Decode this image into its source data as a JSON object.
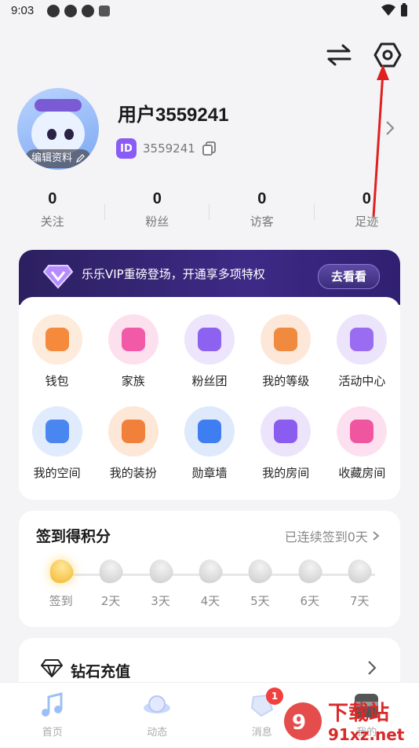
{
  "status_bar": {
    "time": "9:03"
  },
  "profile": {
    "username": "用户3559241",
    "id_badge": "ID",
    "user_id": "3559241",
    "edit_label": "编辑资料"
  },
  "stats": [
    {
      "value": "0",
      "label": "关注"
    },
    {
      "value": "0",
      "label": "粉丝"
    },
    {
      "value": "0",
      "label": "访客"
    },
    {
      "value": "0",
      "label": "足迹"
    }
  ],
  "vip": {
    "text": "乐乐VIP重磅登场，开通享多项特权",
    "button": "去看看"
  },
  "grid": [
    {
      "label": "钱包",
      "icon": "wallet-icon",
      "bg": "#fdebdc",
      "fg": "#f58a3c"
    },
    {
      "label": "家族",
      "icon": "family-icon",
      "bg": "#fde0ee",
      "fg": "#f25aa8"
    },
    {
      "label": "粉丝团",
      "icon": "fan-club-icon",
      "bg": "#ece5fb",
      "fg": "#8e62f0"
    },
    {
      "label": "我的等级",
      "icon": "level-icon",
      "bg": "#fde7d8",
      "fg": "#f08a3e"
    },
    {
      "label": "活动中心",
      "icon": "gift-icon",
      "bg": "#ece4fb",
      "fg": "#9a6cf2"
    },
    {
      "label": "我的空间",
      "icon": "planet-icon",
      "bg": "#e0ebfd",
      "fg": "#4a86f0"
    },
    {
      "label": "我的装扮",
      "icon": "outfit-icon",
      "bg": "#fde7d7",
      "fg": "#f0803a"
    },
    {
      "label": "勋章墙",
      "icon": "medal-icon",
      "bg": "#dee9fc",
      "fg": "#3f7ef0"
    },
    {
      "label": "我的房间",
      "icon": "room-icon",
      "bg": "#ece4fb",
      "fg": "#8b5cf0"
    },
    {
      "label": "收藏房间",
      "icon": "star-room-icon",
      "bg": "#fde0ef",
      "fg": "#f0569f"
    }
  ],
  "sign": {
    "title": "签到得积分",
    "streak": "已连续签到0天",
    "days": [
      "签到",
      "2天",
      "3天",
      "4天",
      "5天",
      "6天",
      "7天"
    ]
  },
  "diamond": {
    "label": "钻石充值"
  },
  "tabs": [
    {
      "label": "首页",
      "icon": "music-icon"
    },
    {
      "label": "动态",
      "icon": "planet-ufo-icon"
    },
    {
      "label": "消息",
      "icon": "message-icon",
      "badge": "1"
    },
    {
      "label": "我的",
      "icon": "profile-icon"
    }
  ],
  "watermark": {
    "text": "下载站",
    "url": "91xz.net"
  }
}
